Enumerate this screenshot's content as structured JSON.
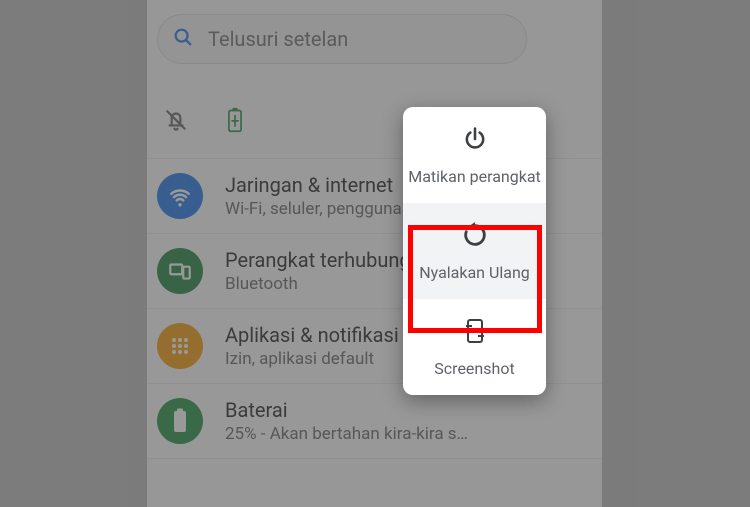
{
  "search": {
    "placeholder": "Telusuri setelan"
  },
  "rows": {
    "network": {
      "title": "Jaringan & internet",
      "sub": "Wi-Fi, seluler, penggunaan data"
    },
    "devices": {
      "title": "Perangkat terhubung",
      "sub": "Bluetooth"
    },
    "apps": {
      "title": "Aplikasi & notifikasi",
      "sub": "Izin, aplikasi default"
    },
    "battery": {
      "title": "Baterai",
      "sub": "25% - Akan bertahan kira-kira s…"
    }
  },
  "power_menu": {
    "power_off": "Matikan perangkat",
    "restart": "Nyalakan Ulang",
    "screenshot": "Screenshot"
  },
  "colors": {
    "network": "#1a73e8",
    "devices": "#188038",
    "apps": "#f9ab00",
    "battery": "#1e8e3e"
  }
}
